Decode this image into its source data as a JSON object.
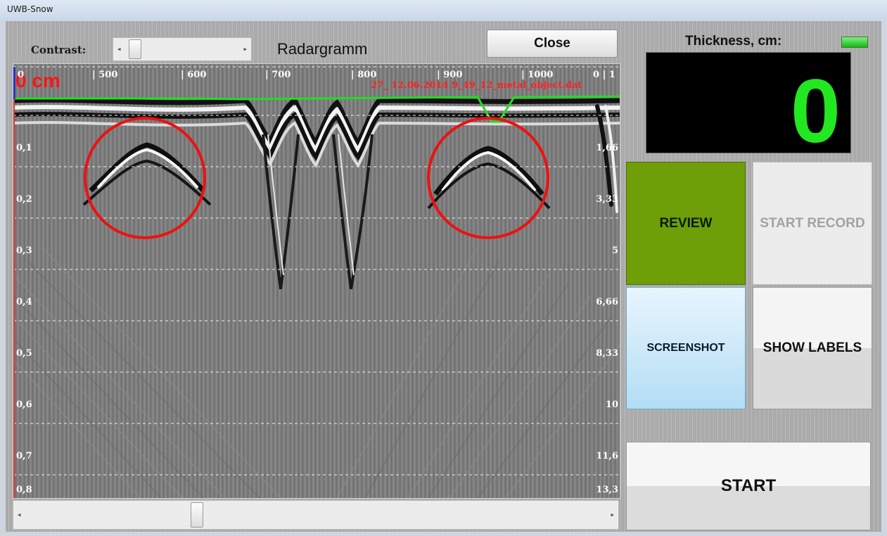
{
  "window": {
    "title": "UWB-Snow"
  },
  "contrast": {
    "label": "Contrast:"
  },
  "radargram": {
    "title": "Radargramm",
    "depth_unit": "0 cm",
    "file_label": "27_ 12.06.2014 9_49_12_metal_object.dat",
    "top_ticks": [
      "0",
      "| 500",
      "| 600",
      "| 700",
      "| 800",
      "| 900",
      "| 1000",
      "0 | 1"
    ],
    "left_depths": [
      "0,1",
      "0,2",
      "0,3",
      "0,4",
      "0,5",
      "0,6",
      "0,7",
      "0,8"
    ],
    "right_depths": [
      "1,66",
      "3,33",
      "5",
      "6,66",
      "8,33",
      "10",
      "11,6",
      "13,3"
    ]
  },
  "buttons": {
    "close": "Close",
    "review": "REVIEW",
    "start_record": "START RECORD",
    "screenshot": "SCREENSHOT",
    "show_labels": "SHOW LABELS",
    "start": "START"
  },
  "thickness": {
    "label": "Thickness, cm:",
    "value": "0"
  },
  "colors": {
    "review": "#6e9e08",
    "screenshot": "#b3ddf5",
    "thickness_value": "#22e822",
    "surface_line": "#22dd22",
    "annotation": "#ff0000",
    "indicator_led": "#22cc22"
  },
  "icons": {
    "scroll_left": "left-arrow-icon",
    "scroll_right": "right-arrow-icon",
    "led": "status-led-icon"
  }
}
